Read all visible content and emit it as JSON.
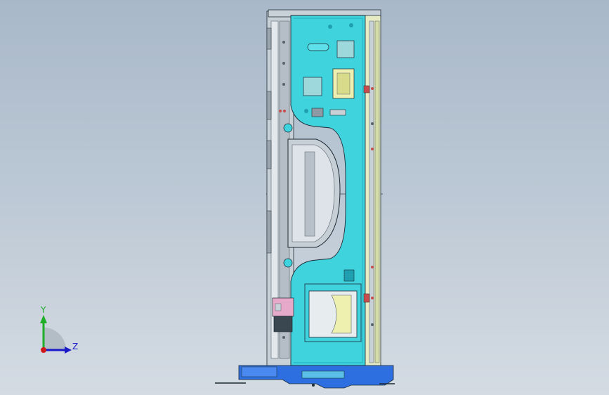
{
  "viewport": {
    "background_top": "#a9b8c9",
    "background_bottom": "#d4dbe3"
  },
  "model": {
    "colors": {
      "cyan_panel": "#3fd3de",
      "cyan_dark": "#1f9fb0",
      "steel": "#c9d1d8",
      "steel_dark": "#8e99a3",
      "yellow_part": "#eef0b0",
      "blue_base": "#2d6fe0",
      "red_fastener": "#c84c4c",
      "edge_line": "#1c2a33"
    }
  },
  "triad": {
    "y_label": "Y",
    "z_label": "Z",
    "y_color": "#1fae2a",
    "z_color": "#1a1ac8",
    "origin_color": "#d01818",
    "y_icon": "y-axis-arrow",
    "z_icon": "z-axis-arrow"
  }
}
